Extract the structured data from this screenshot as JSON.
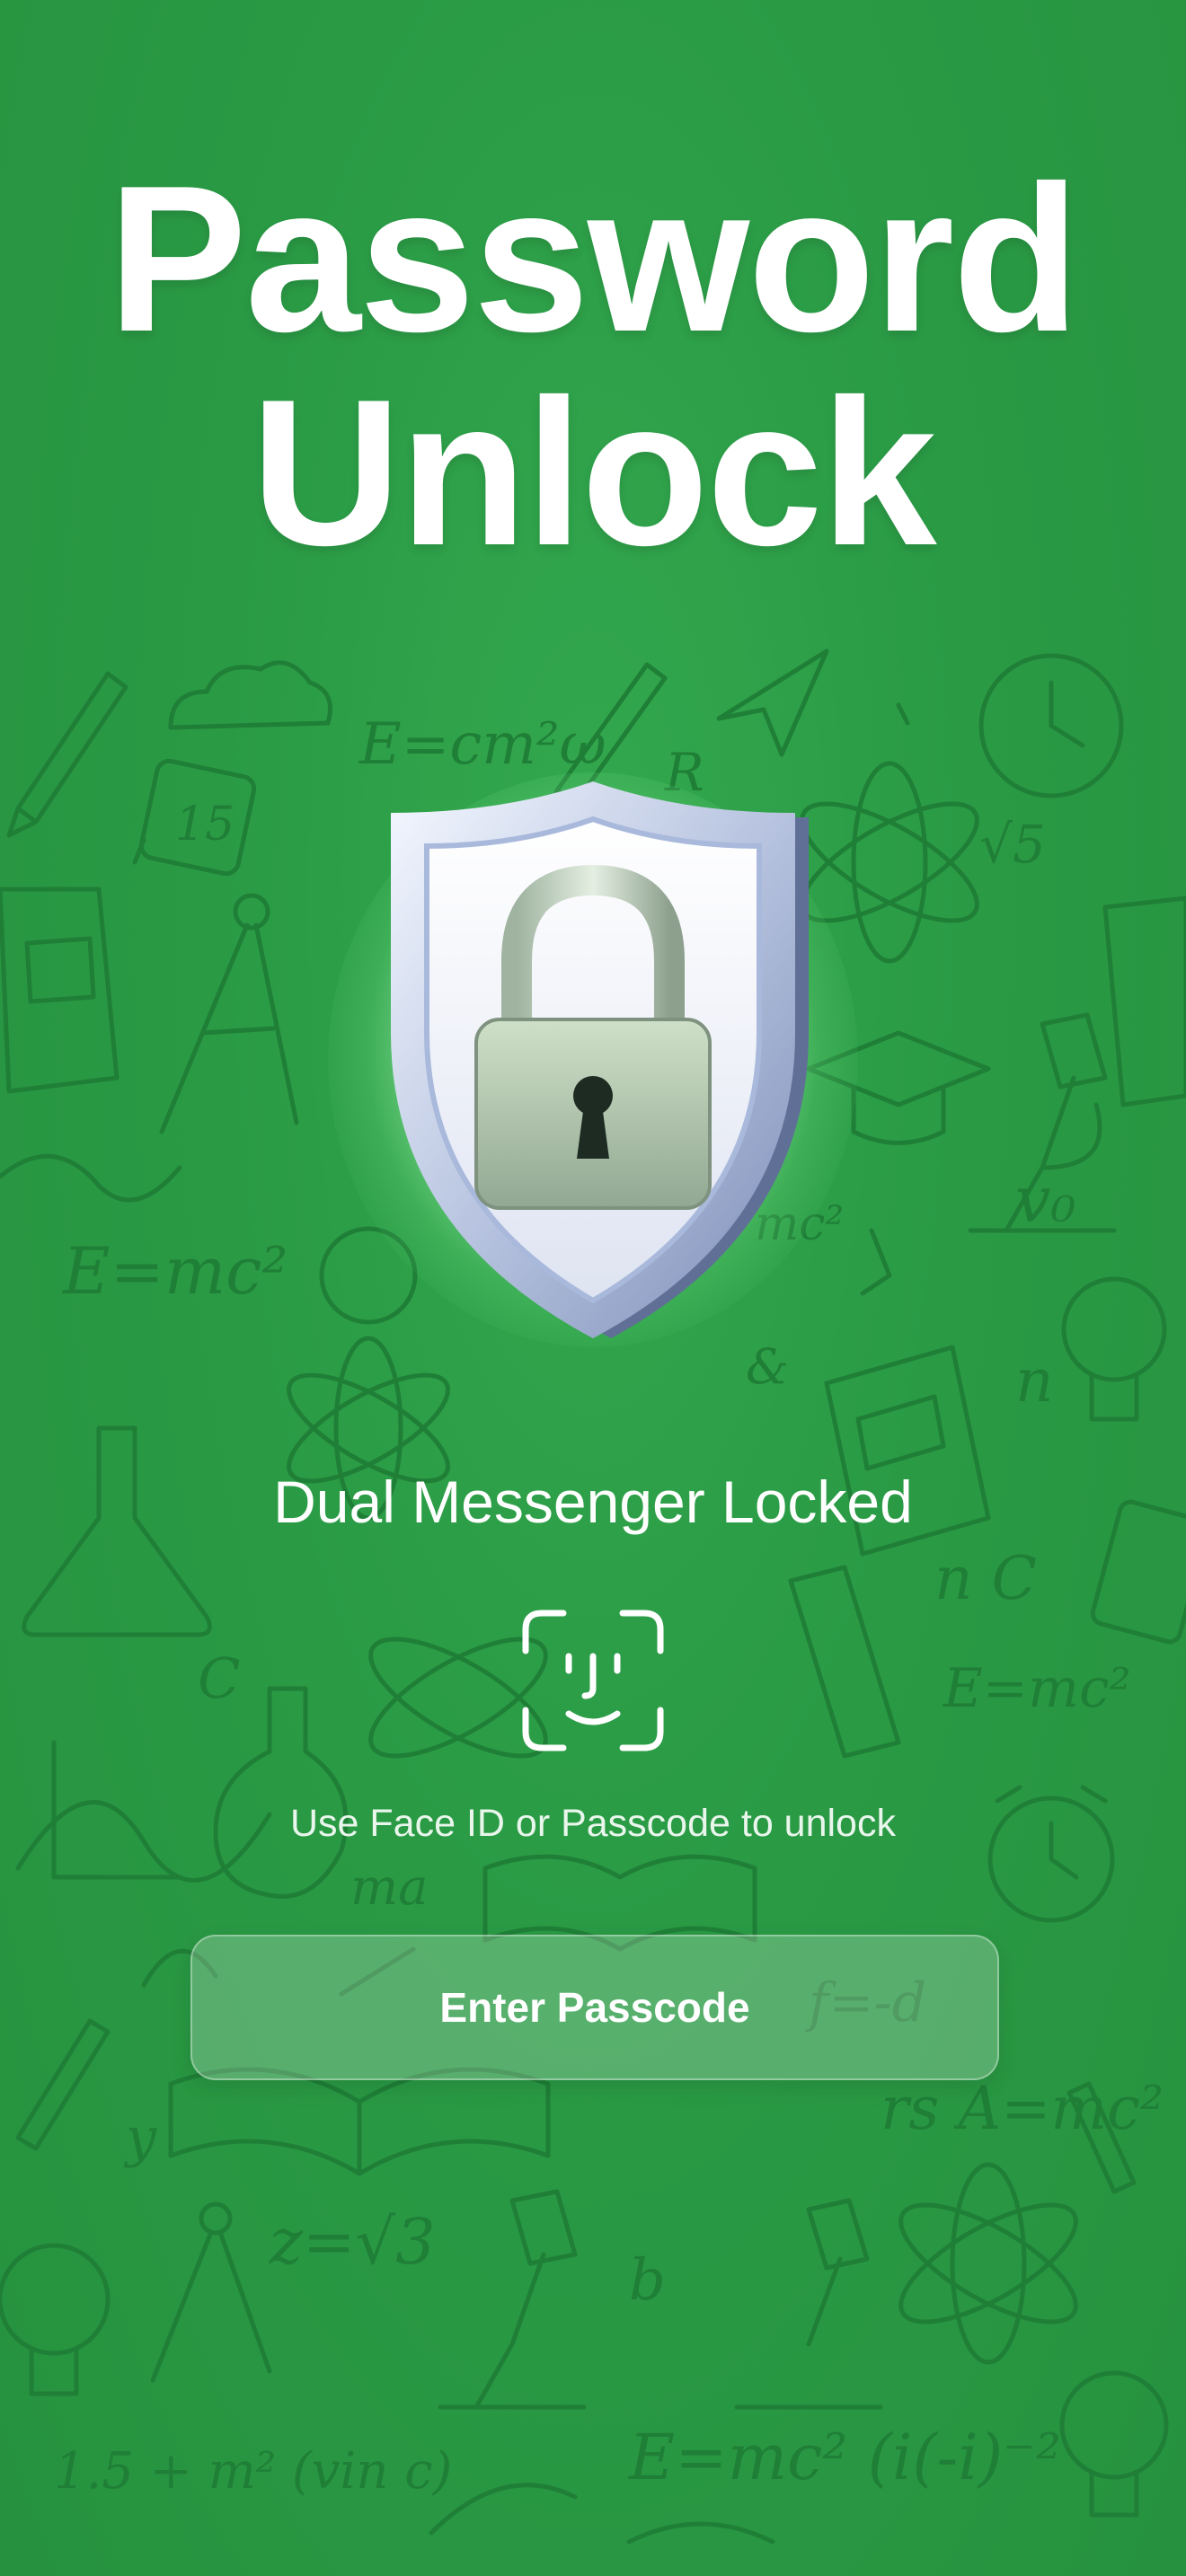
{
  "header": {
    "title_line1": "Password",
    "title_line2": "Unlock"
  },
  "lock_screen": {
    "status": "Dual Messenger Locked",
    "hint": "Use Face ID or Passcode to unlock",
    "enter_passcode_label": "Enter Passcode"
  },
  "icons": {
    "hero": "shield-padlock-icon",
    "biometric": "face-id-icon"
  },
  "colors": {
    "background": "#2a9a45",
    "doodles": "#1f7f37",
    "text": "#ffffff",
    "button_fill": "rgba(255,255,255,0.22)"
  }
}
